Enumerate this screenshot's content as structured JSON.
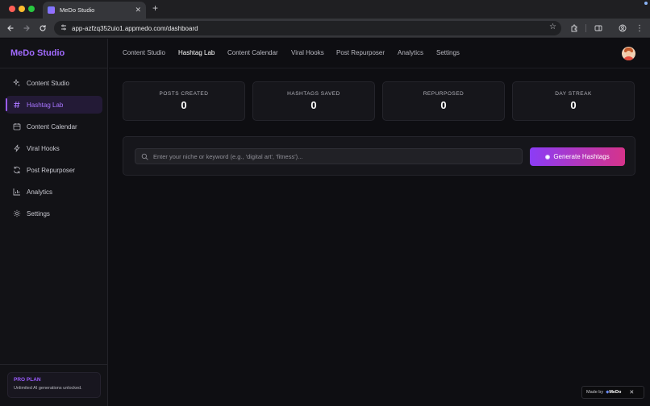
{
  "browser": {
    "tab_title": "MeDo Studio",
    "url": "app-azfzq352uio1.appmedo.com/dashboard"
  },
  "brand": "MeDo Studio",
  "sidebar": {
    "items": [
      {
        "label": "Content Studio",
        "icon": "sparkles-icon"
      },
      {
        "label": "Hashtag Lab",
        "icon": "hash-icon",
        "active": true
      },
      {
        "label": "Content Calendar",
        "icon": "calendar-icon"
      },
      {
        "label": "Viral Hooks",
        "icon": "lightning-icon"
      },
      {
        "label": "Post Repurposer",
        "icon": "refresh-icon"
      },
      {
        "label": "Analytics",
        "icon": "bar-chart-icon"
      },
      {
        "label": "Settings",
        "icon": "gear-icon"
      }
    ],
    "plan": {
      "title": "PRO PLAN",
      "description": "Unlimited AI generations unlocked."
    }
  },
  "topnav": {
    "items": [
      "Content Studio",
      "Hashtag Lab",
      "Content Calendar",
      "Viral Hooks",
      "Post Repurposer",
      "Analytics",
      "Settings"
    ],
    "active": "Hashtag Lab"
  },
  "stats": [
    {
      "label": "POSTS CREATED",
      "value": "0"
    },
    {
      "label": "HASHTAGS SAVED",
      "value": "0"
    },
    {
      "label": "REPURPOSED",
      "value": "0"
    },
    {
      "label": "DAY STREAK",
      "value": "0"
    }
  ],
  "generator": {
    "placeholder": "Enter your niche or keyword (e.g., 'digital art', 'fitness')...",
    "value": "",
    "button_label": "Generate Hashtags"
  },
  "made_by": {
    "prefix": "Made by",
    "logo": "MeDo"
  },
  "colors": {
    "accent": "#9b5cff",
    "button_start": "#8b3cf6",
    "button_end": "#d6338a"
  }
}
